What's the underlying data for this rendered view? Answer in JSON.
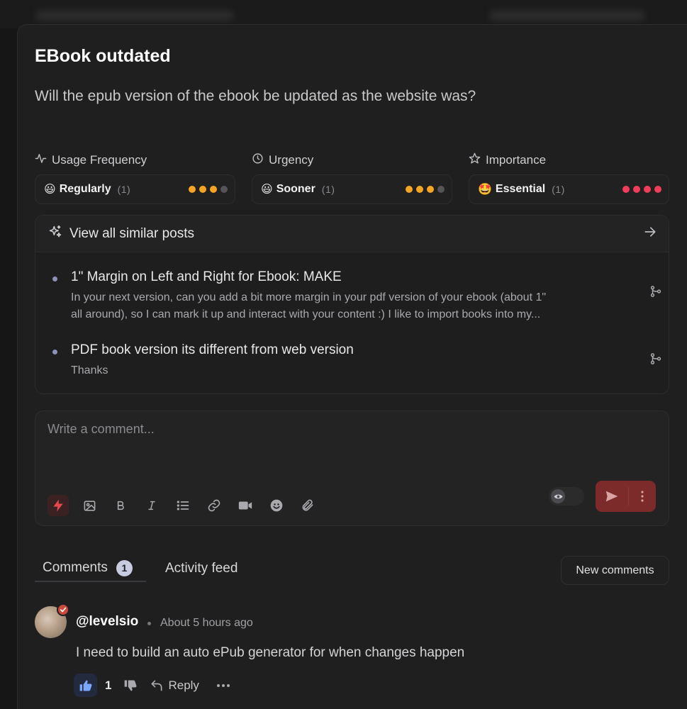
{
  "post": {
    "title": "EBook outdated",
    "description": "Will the epub version of the ebook be updated as the website was?"
  },
  "metrics": [
    {
      "label": "Usage Frequency",
      "icon": "activity-icon",
      "emoji": "😃",
      "value": "Regularly",
      "count": "(1)",
      "level": 3,
      "max": 4,
      "color": "#f5a524"
    },
    {
      "label": "Urgency",
      "icon": "clock-icon",
      "emoji": "😃",
      "value": "Sooner",
      "count": "(1)",
      "level": 3,
      "max": 4,
      "color": "#f5a524"
    },
    {
      "label": "Importance",
      "icon": "star-icon",
      "emoji": "🤩",
      "value": "Essential",
      "count": "(1)",
      "level": 4,
      "max": 4,
      "color": "#f03e5a"
    }
  ],
  "similar": {
    "label": "View all similar posts",
    "posts": [
      {
        "title": "1\" Margin on Left and Right for Ebook: MAKE",
        "body_line1": "In your next version, can you add a bit more margin in your pdf version of your ebook (about 1\"",
        "body_line2": "all around), so I can mark it up and interact with your content :) I like to import books into my..."
      },
      {
        "title": "PDF book version its different from web version",
        "body_line1": "Thanks"
      }
    ]
  },
  "composer": {
    "placeholder": "Write a comment...",
    "tools": [
      "lightning-icon",
      "image-icon",
      "bold-icon",
      "italic-icon",
      "list-icon",
      "link-icon",
      "video-icon",
      "emoji-icon",
      "attachment-icon"
    ]
  },
  "tabs": {
    "comments_label": "Comments",
    "comments_count": "1",
    "activity_label": "Activity feed",
    "new_comments_label": "New comments"
  },
  "comment": {
    "author": "@levelsio",
    "time": "About 5 hours ago",
    "body": "I need to build an auto ePub generator for when changes happen",
    "likes": "1",
    "reply_label": "Reply"
  },
  "colors": {
    "accent_red": "#c94a3d",
    "send_bg": "#7d2a2a",
    "dot_empty": "#555559"
  }
}
